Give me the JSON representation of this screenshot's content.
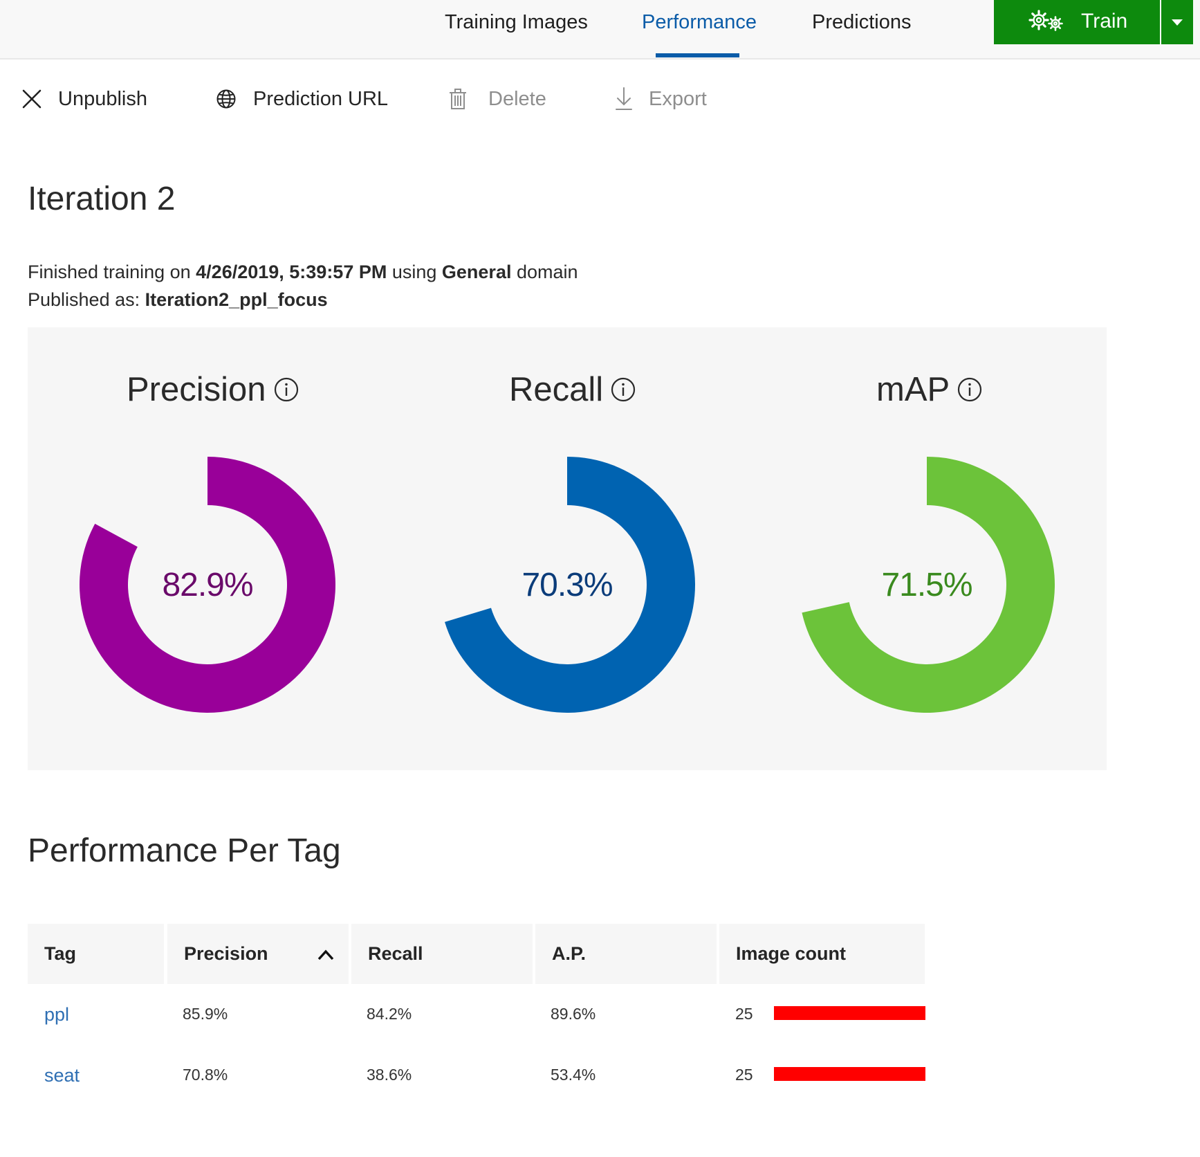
{
  "nav": {
    "tabs": [
      {
        "label": "Training Images"
      },
      {
        "label": "Performance"
      },
      {
        "label": "Predictions"
      }
    ],
    "active_tab": "Performance",
    "train_label": "Train",
    "train_color": "#0d8a0d"
  },
  "commands": {
    "unpublish": "Unpublish",
    "prediction_url": "Prediction URL",
    "delete": "Delete",
    "export": "Export"
  },
  "iteration": {
    "title": "Iteration 2",
    "finished_prefix": "Finished training on ",
    "finished_date": "4/26/2019, 5:39:57 PM",
    "finished_using": " using ",
    "domain": "General",
    "domain_suffix": " domain",
    "published_prefix": "Published as: ",
    "published_name": "Iteration2_ppl_focus"
  },
  "metrics": [
    {
      "title": "Precision",
      "value_text": "82.9%",
      "value": 82.9,
      "color": "#990099",
      "text_color": "#6a0a6a"
    },
    {
      "title": "Recall",
      "value_text": "70.3%",
      "value": 70.3,
      "color": "#0063b1",
      "text_color": "#0b3c7a"
    },
    {
      "title": "mAP",
      "value_text": "71.5%",
      "value": 71.5,
      "color": "#6cc33a",
      "text_color": "#3a8a1e"
    }
  ],
  "per_tag": {
    "title": "Performance Per Tag",
    "columns": [
      "Tag",
      "Precision",
      "Recall",
      "A.P.",
      "Image count"
    ],
    "sort_column": "Precision",
    "bar_color": "#ff0000",
    "rows": [
      {
        "tag": "ppl",
        "precision": "85.9%",
        "recall": "84.2%",
        "ap": "89.6%",
        "image_count": "25",
        "count_fraction": 1.0
      },
      {
        "tag": "seat",
        "precision": "70.8%",
        "recall": "38.6%",
        "ap": "53.4%",
        "image_count": "25",
        "count_fraction": 1.0
      }
    ]
  }
}
